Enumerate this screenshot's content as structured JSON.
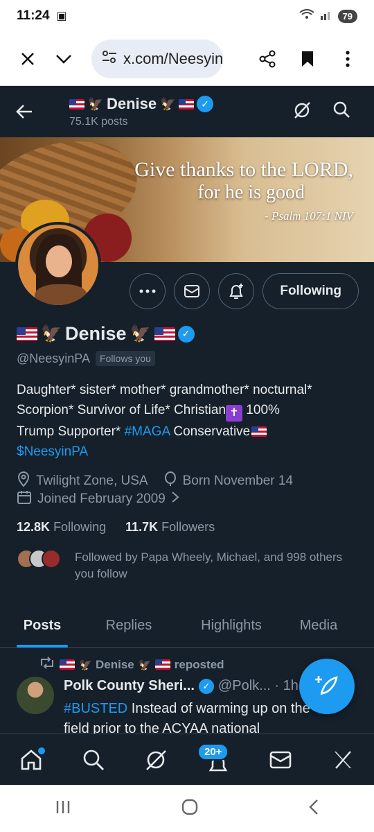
{
  "status_bar": {
    "time": "11:24",
    "battery": "79"
  },
  "browser": {
    "url": "x.com/NeesyinPA"
  },
  "header": {
    "name": "Denise",
    "posts_count": "75.1K posts"
  },
  "banner": {
    "line1": "Give thanks to the LORD,",
    "line2": "for he is good",
    "citation": "- Psalm 107:1 NIV"
  },
  "profile": {
    "display_name": "Denise",
    "handle": "@NeesyinPA",
    "follows_you": "Follows you",
    "following_button": "Following",
    "bio_line1": "Daughter* sister* mother* grandmother* nocturnal*",
    "bio_line2_a": "Scorpion* Survivor of Life* Christian",
    "bio_line2_b": " 100%",
    "bio_line3_a": "Trump Supporter* ",
    "bio_hashtag": "#MAGA",
    "bio_line3_b": " Conservative",
    "bio_cashtag": "$NeesyinPA",
    "location": "Twilight Zone, USA",
    "birthday": "Born November 14",
    "joined": "Joined February 2009",
    "following_count": "12.8K",
    "following_label": "Following",
    "followers_count": "11.7K",
    "followers_label": "Followers",
    "followed_by": "Followed by Papa Wheely, Michael, and 998 others you follow"
  },
  "tabs": [
    "Posts",
    "Replies",
    "Highlights",
    "Media"
  ],
  "post": {
    "repost_by": "Denise",
    "reposted_label": "reposted",
    "author": "Polk County Sheri...",
    "handle_time": "@Polk... · 1h",
    "hashtag": "#BUSTED",
    "text_a": " Instead of warming up on the",
    "text_b": "field prior to the ACYAA national"
  },
  "bottom_nav": {
    "notifications_badge": "20+"
  },
  "colors": {
    "background": "#15202b",
    "accent": "#1d9bf0",
    "muted": "#8b98a5"
  }
}
